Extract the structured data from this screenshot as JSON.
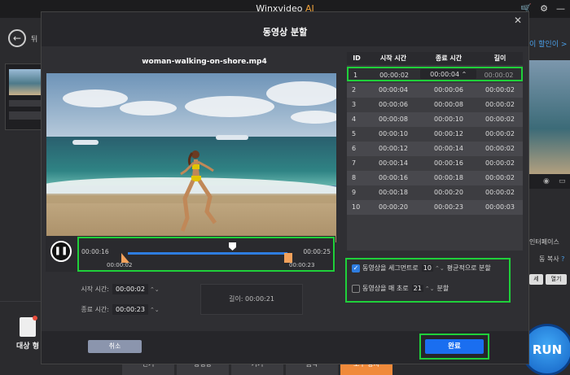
{
  "app": {
    "title": "Winxvideo",
    "title_ai": "AI",
    "back_label": "뒤",
    "discount_link": "이 할인이 >",
    "target_label": "대상 형",
    "interface_label": "인터페이스",
    "copy_label": "동 복사",
    "help": "?",
    "btn_small_1": "세",
    "btn_small_2": "열기",
    "run_label": "RUN"
  },
  "bottom_tabs": [
    "인기",
    "동영상",
    "기기",
    "음악",
    "도구 상자"
  ],
  "dialog": {
    "title": "동영상 분할",
    "close": "✕",
    "file_name": "woman-walking-on-shore.mp4",
    "player": {
      "time_start": "00:00:16",
      "time_end": "00:00:25",
      "marker_left": "00:00:02",
      "marker_right": "00:00:23"
    },
    "time_panel": {
      "start_label": "시작 시간:",
      "start_value": "00:00:02",
      "end_label": "종료 시간:",
      "end_value": "00:00:23",
      "length_label": "길이: 00:00:21"
    },
    "table": {
      "headers": [
        "ID",
        "시작 시간",
        "종료 시간",
        "길이"
      ],
      "rows": [
        {
          "id": "1",
          "start": "00:00:02",
          "end": "00:00:04",
          "len": "00:00:02"
        },
        {
          "id": "2",
          "start": "00:00:04",
          "end": "00:00:06",
          "len": "00:00:02"
        },
        {
          "id": "3",
          "start": "00:00:06",
          "end": "00:00:08",
          "len": "00:00:02"
        },
        {
          "id": "4",
          "start": "00:00:08",
          "end": "00:00:10",
          "len": "00:00:02"
        },
        {
          "id": "5",
          "start": "00:00:10",
          "end": "00:00:12",
          "len": "00:00:02"
        },
        {
          "id": "6",
          "start": "00:00:12",
          "end": "00:00:14",
          "len": "00:00:02"
        },
        {
          "id": "7",
          "start": "00:00:14",
          "end": "00:00:16",
          "len": "00:00:02"
        },
        {
          "id": "8",
          "start": "00:00:16",
          "end": "00:00:18",
          "len": "00:00:02"
        },
        {
          "id": "9",
          "start": "00:00:18",
          "end": "00:00:20",
          "len": "00:00:02"
        },
        {
          "id": "10",
          "start": "00:00:20",
          "end": "00:00:23",
          "len": "00:00:03"
        }
      ]
    },
    "options": {
      "opt1_checked": true,
      "opt1_prefix": "동영상을 세그먼트로",
      "opt1_value": "10",
      "opt1_suffix": "평균적으로 분할",
      "opt2_checked": false,
      "opt2_prefix": "동영상을 매 초로",
      "opt2_value": "21",
      "opt2_suffix": "분할"
    },
    "cancel_label": "취소",
    "ok_label": "완료"
  },
  "colors": {
    "highlight": "#1fd03a",
    "accent_blue": "#1a6ef0",
    "marker_orange": "#f2a15b",
    "ai_orange": "#f0a23b"
  }
}
